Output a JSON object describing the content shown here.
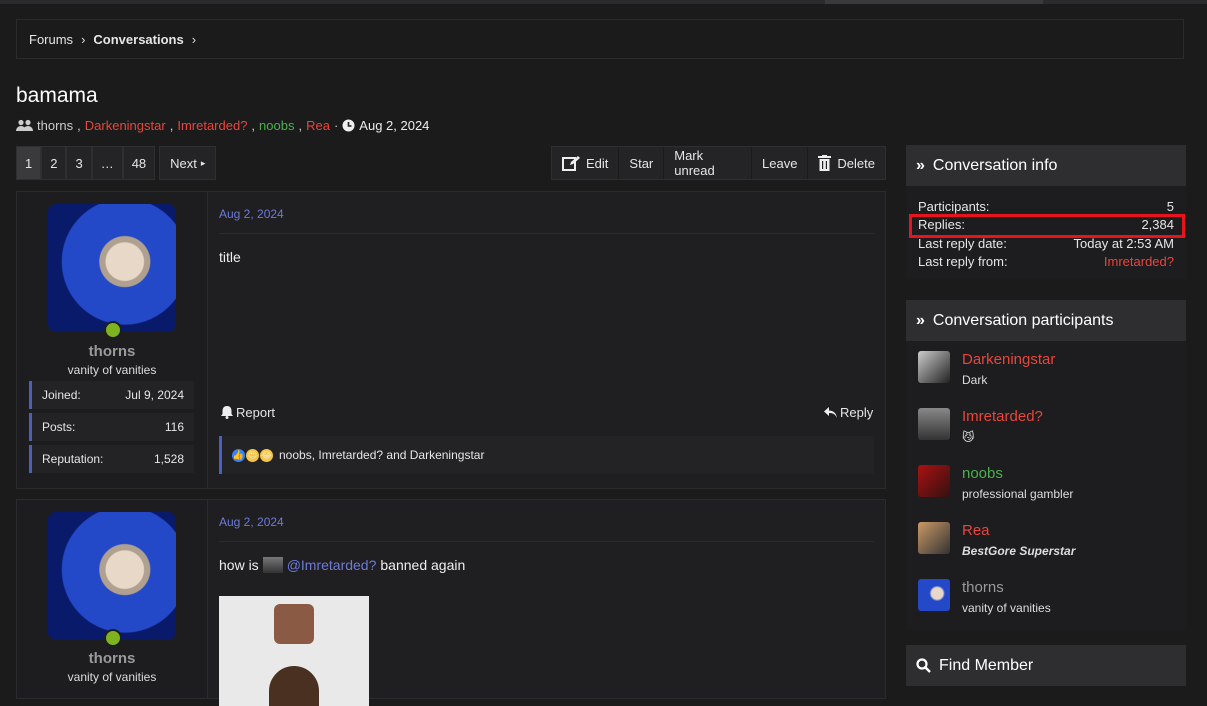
{
  "breadcrumb": {
    "forums": "Forums",
    "current": "Conversations"
  },
  "conversation": {
    "title": "bamama",
    "participants_meta": [
      "thorns",
      "Darkeningstar",
      "Imretarded?",
      "noobs",
      "Rea"
    ],
    "date": "Aug 2, 2024"
  },
  "pager": {
    "pages": [
      "1",
      "2",
      "3",
      "…",
      "48"
    ],
    "next": "Next",
    "active": "1"
  },
  "actions": {
    "edit": "Edit",
    "star": "Star",
    "mark_unread": "Mark unread",
    "leave": "Leave",
    "delete": "Delete"
  },
  "posts": [
    {
      "user": "thorns",
      "user_title": "vanity of vanities",
      "stats": [
        {
          "label": "Joined:",
          "value": "Jul 9, 2024"
        },
        {
          "label": "Posts:",
          "value": "116"
        },
        {
          "label": "Reputation:",
          "value": "1,528"
        }
      ],
      "date": "Aug 2, 2024",
      "body": "title",
      "report": "Report",
      "reply": "Reply",
      "reactions_text": "noobs, Imretarded? and Darkeningstar"
    },
    {
      "user": "thorns",
      "user_title": "vanity of vanities",
      "date": "Aug 2, 2024",
      "body_prefix": "how is",
      "mention": "@Imretarded?",
      "body_suffix": "banned again"
    }
  ],
  "conversation_info": {
    "heading": "Conversation info",
    "rows": [
      {
        "label": "Participants:",
        "value": "5"
      },
      {
        "label": "Replies:",
        "value": "2,384"
      },
      {
        "label": "Last reply date:",
        "value": "Today at 2:53 AM"
      },
      {
        "label": "Last reply from:",
        "value": "Imretarded?"
      }
    ]
  },
  "participants_box": {
    "heading": "Conversation participants",
    "list": [
      {
        "name": "Darkeningstar",
        "title": "Dark",
        "color": "#e8453c"
      },
      {
        "name": "Imretarded?",
        "title": "😼",
        "color": "#e8453c"
      },
      {
        "name": "noobs",
        "title": "professional gambler",
        "color": "#4caf50"
      },
      {
        "name": "Rea",
        "title": "BestGore Superstar",
        "color": "#e8453c"
      },
      {
        "name": "thorns",
        "title": "vanity of vanities",
        "color": "#9a9a9a"
      }
    ]
  },
  "find_member": {
    "heading": "Find Member"
  }
}
